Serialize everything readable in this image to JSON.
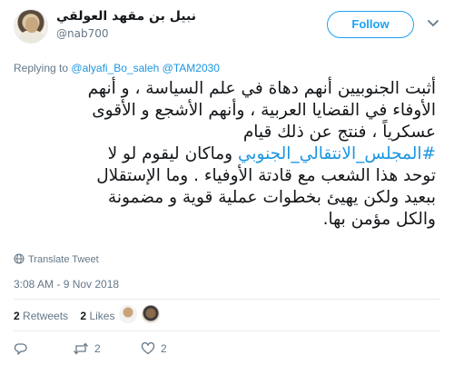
{
  "author": {
    "name": "نبيل بن مقهد العولقي",
    "handle": "@nab700"
  },
  "follow_button": {
    "label": "Follow"
  },
  "replying": {
    "prefix": "Replying to",
    "mentions": [
      "@alyafi_Bo_saleh",
      "@TAM2030"
    ]
  },
  "tweet": {
    "line1": "أثبت الجنوبيين أنهم دهاة في علم السياسة ، و أنهم",
    "line2": "الأوفاء في القضايا العربية ، وأنهم الأشجع و الأقوى",
    "line3": "عسكرياً ، فنتج عن ذلك قيام",
    "hashtag": "#المجلس_الانتقالي_الجنوبي",
    "line4_rest": " وماكان ليقوم لو لا",
    "line5": "توحد هذا الشعب مع قادتة الأوفياء . وما الإستقلال",
    "line6": "ببعيد ولكن يهيئ بخطوات عملية قوية و مضمونة",
    "line7": "والكل مؤمن بها."
  },
  "translate_label": "Translate Tweet",
  "timestamp": "3:08 AM - 9 Nov 2018",
  "stats": {
    "retweets_count": "2",
    "retweets_label": "Retweets",
    "likes_count": "2",
    "likes_label": "Likes"
  },
  "actions": {
    "retweet_count": "2",
    "like_count": "2"
  },
  "colors": {
    "accent": "#1da1f2",
    "link": "#1b95e0",
    "muted": "#657786"
  },
  "icons": [
    "chevron-down-icon",
    "globe-icon",
    "reply-icon",
    "retweet-icon",
    "heart-icon",
    "avatar"
  ]
}
